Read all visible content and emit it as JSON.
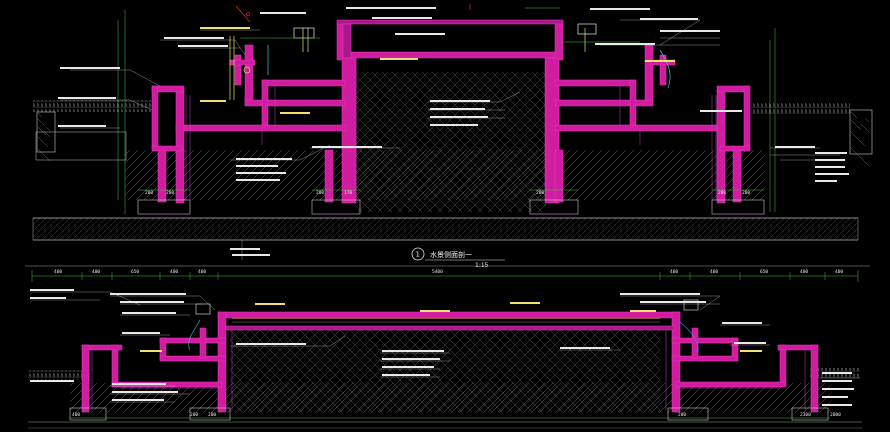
{
  "colors": {
    "background": "#000000",
    "concrete_fill": "#d01c9e",
    "concrete_outline": "#f038c8",
    "structure_line": "#c040c0",
    "dimension": "#40c040",
    "leader": "#30d0d0",
    "hatch": "#707070",
    "soil_hatch": "#5a5a5a",
    "ground": "#9a9a9a",
    "text_white": "#e8e8e8",
    "text_yellow": "#f0e070",
    "text_green": "#58e058",
    "water": "#4090ff",
    "red": "#ff3030"
  },
  "section_1": {
    "number": "1",
    "title": "水景侧面剖一",
    "scale": "1:15",
    "dims_bottom": [
      "200",
      "200",
      "200",
      "170",
      "200",
      "200",
      "200"
    ]
  },
  "section_2": {
    "dims_top": [
      "400",
      "400",
      "650",
      "400",
      "400",
      "5400",
      "400",
      "400",
      "650",
      "400",
      "400"
    ],
    "dims_bottom": [
      "400",
      "200",
      "200",
      "200",
      "2300",
      "2000"
    ]
  }
}
